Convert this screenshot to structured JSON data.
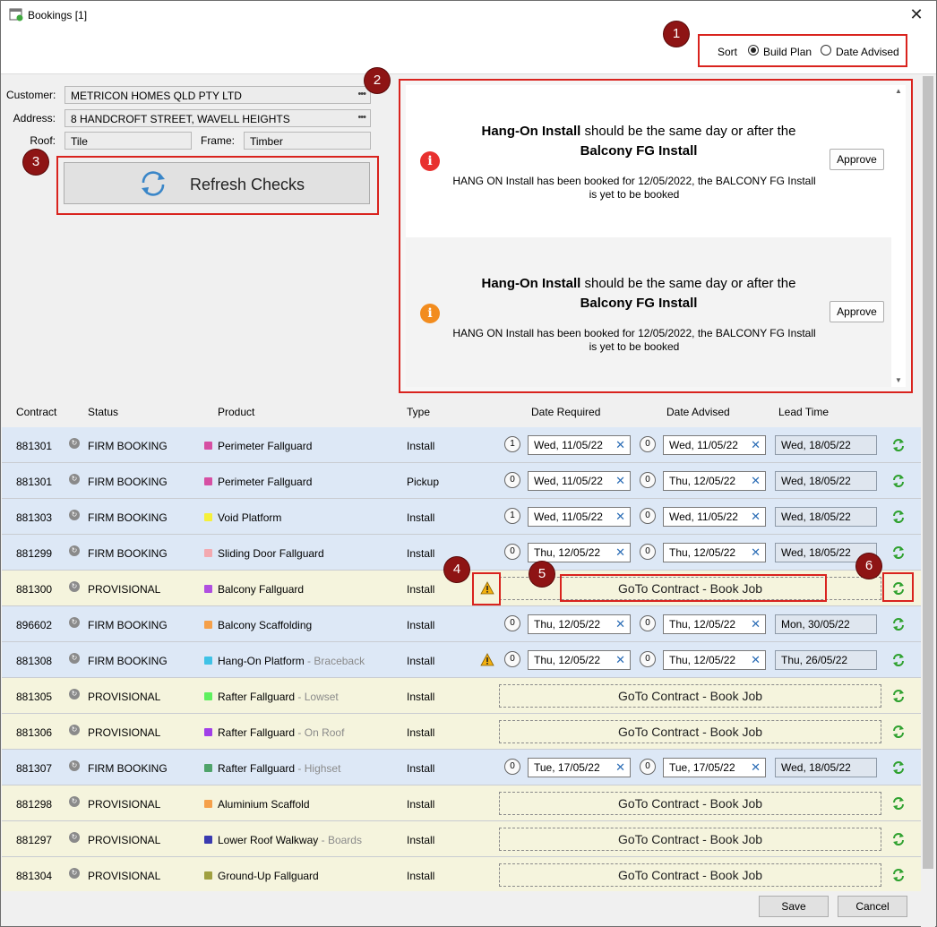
{
  "window": {
    "title": "Bookings [1]",
    "close_glyph": "✕"
  },
  "sort": {
    "label": "Sort",
    "options": [
      {
        "label": "Build Plan",
        "selected": true
      },
      {
        "label": "Date Advised",
        "selected": false
      }
    ]
  },
  "callouts": [
    "1",
    "2",
    "3",
    "4",
    "5",
    "6"
  ],
  "details": {
    "customer_label": "Customer:",
    "customer_value": "METRICON HOMES QLD PTY LTD",
    "address_label": "Address:",
    "address_value": "8 HANDCROFT STREET, WAVELL HEIGHTS",
    "roof_label": "Roof:",
    "roof_value": "Tile",
    "frame_label": "Frame:",
    "frame_value": "Timber",
    "ellipsis": "•••"
  },
  "refresh": {
    "label": "Refresh Checks",
    "icon": "refresh-icon"
  },
  "checks": [
    {
      "title_bold_1": "Hang-On Install",
      "title_mid": " should be the same day or after the",
      "title_bold_2": "Balcony FG Install",
      "message": "HANG ON Install has been booked for 12/05/2022, the BALCONY FG Install is yet to be booked",
      "severity_color": "#e8312f",
      "approve_label": "Approve",
      "icon_glyph": "i"
    },
    {
      "title_bold_1": "Hang-On Install",
      "title_mid": " should be the same day or after the",
      "title_bold_2": "Balcony FG Install",
      "message": "HANG ON Install has been booked for 12/05/2022, the BALCONY FG Install is yet to be booked",
      "severity_color": "#f28c1e",
      "approve_label": "Approve",
      "icon_glyph": "i"
    }
  ],
  "scroll_arrows": {
    "up": "▲",
    "down": "▼"
  },
  "columns": {
    "contract": "Contract",
    "status": "Status",
    "product": "Product",
    "type": "Type",
    "date_required": "Date Required",
    "date_advised": "Date Advised",
    "lead_time": "Lead Time"
  },
  "goto_label": "GoTo Contract - Book Job",
  "rows": [
    {
      "contract": "881301",
      "status": "FIRM BOOKING",
      "product": "Perimeter Fallguard",
      "sub": "",
      "swatch": "#d64fa3",
      "type": "Install",
      "req_count": "1",
      "req_date": "Wed, 11/05/22",
      "adv_count": "0",
      "adv_date": "Wed, 11/05/22",
      "lead": "Wed, 18/05/22"
    },
    {
      "contract": "881301",
      "status": "FIRM BOOKING",
      "product": "Perimeter Fallguard",
      "sub": "",
      "swatch": "#d64fa3",
      "type": "Pickup",
      "req_count": "0",
      "req_date": "Wed, 11/05/22",
      "adv_count": "0",
      "adv_date": "Thu, 12/05/22",
      "lead": "Wed, 18/05/22"
    },
    {
      "contract": "881303",
      "status": "FIRM BOOKING",
      "product": "Void Platform",
      "sub": "",
      "swatch": "#f5f03a",
      "type": "Install",
      "req_count": "1",
      "req_date": "Wed, 11/05/22",
      "adv_count": "0",
      "adv_date": "Wed, 11/05/22",
      "lead": "Wed, 18/05/22"
    },
    {
      "contract": "881299",
      "status": "FIRM BOOKING",
      "product": "Sliding Door Fallguard",
      "sub": "",
      "swatch": "#f3a9b0",
      "type": "Install",
      "req_count": "0",
      "req_date": "Thu, 12/05/22",
      "adv_count": "0",
      "adv_date": "Thu, 12/05/22",
      "lead": "Wed, 18/05/22"
    },
    {
      "contract": "881300",
      "status": "PROVISIONAL",
      "product": "Balcony Fallguard",
      "sub": "",
      "swatch": "#b04fe0",
      "type": "Install",
      "goto": true,
      "warn": true
    },
    {
      "contract": "896602",
      "status": "FIRM BOOKING",
      "product": "Balcony Scaffolding",
      "sub": "",
      "swatch": "#f5a04a",
      "type": "Install",
      "req_count": "0",
      "req_date": "Thu, 12/05/22",
      "adv_count": "0",
      "adv_date": "Thu, 12/05/22",
      "lead": "Mon, 30/05/22"
    },
    {
      "contract": "881308",
      "status": "FIRM BOOKING",
      "product": "Hang-On Platform",
      "sub": "Braceback",
      "swatch": "#3fc2e6",
      "type": "Install",
      "req_count": "0",
      "req_date": "Thu, 12/05/22",
      "adv_count": "0",
      "adv_date": "Thu, 12/05/22",
      "lead": "Thu, 26/05/22",
      "warn": true
    },
    {
      "contract": "881305",
      "status": "PROVISIONAL",
      "product": "Rafter Fallguard",
      "sub": "Lowset",
      "swatch": "#5ef05e",
      "type": "Install",
      "goto": true
    },
    {
      "contract": "881306",
      "status": "PROVISIONAL",
      "product": "Rafter Fallguard",
      "sub": "On Roof",
      "swatch": "#a13fe8",
      "type": "Install",
      "goto": true
    },
    {
      "contract": "881307",
      "status": "FIRM BOOKING",
      "product": "Rafter Fallguard",
      "sub": "Highset",
      "swatch": "#4fa36a",
      "type": "Install",
      "req_count": "0",
      "req_date": "Tue, 17/05/22",
      "adv_count": "0",
      "adv_date": "Tue, 17/05/22",
      "lead": "Wed, 18/05/22"
    },
    {
      "contract": "881298",
      "status": "PROVISIONAL",
      "product": "Aluminium Scaffold",
      "sub": "",
      "swatch": "#f5a04a",
      "type": "Install",
      "goto": true
    },
    {
      "contract": "881297",
      "status": "PROVISIONAL",
      "product": "Lower Roof Walkway",
      "sub": "Boards",
      "swatch": "#3a3ab0",
      "type": "Install",
      "goto": true
    },
    {
      "contract": "881304",
      "status": "PROVISIONAL",
      "product": "Ground-Up Fallguard",
      "sub": "",
      "swatch": "#a0a040",
      "type": "Install",
      "goto": true
    }
  ],
  "footer": {
    "save": "Save",
    "cancel": "Cancel"
  },
  "colors": {
    "firm_row": "#dde8f6",
    "provisional_row": "#f5f4dd",
    "callout_bg": "#8e1414",
    "highlight": "#d9231e"
  }
}
